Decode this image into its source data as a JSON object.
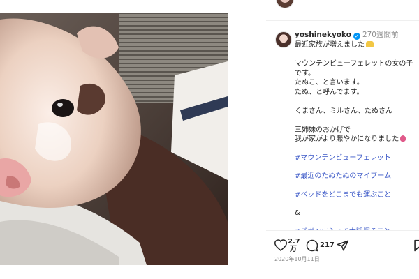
{
  "post": {
    "username": "yoshinekyoko",
    "time_ago": "270週間前",
    "date": "2020年10月11日",
    "likes_number": "2.7",
    "likes_unit": "万",
    "comments": "217"
  },
  "caption": {
    "line1": "最近家族が増えました",
    "para1": [
      "マウンテンビューフェレットの女の子です。",
      "たぬこ、と言います。",
      "たぬ、と呼んでます。"
    ],
    "para2": "くまさん、ミルさん、たぬさん",
    "para3": [
      "三姉妹のおかげで",
      "我が家がより賑やかになりました"
    ],
    "hashtags": [
      "#マウンテンビューフェレット",
      "#最近のたぬたぬのマイブーム",
      "#ベッドをどこまでも運ぶこと"
    ],
    "ampersand": "&",
    "hashtag_cut": "#ズボンに入って大腿掘ること"
  },
  "icons": {
    "verified": "verified-badge-icon",
    "like": "heart-icon",
    "comment": "comment-bubble-icon",
    "share": "share-paper-plane-icon",
    "save": "bookmark-icon"
  },
  "colors": {
    "hashtag": "#3a57c7",
    "verified": "#0095f6",
    "meta": "#8e8e8e"
  }
}
